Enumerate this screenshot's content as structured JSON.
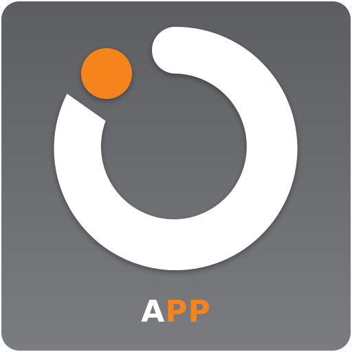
{
  "app": {
    "name_first": "A",
    "name_rest": "PP"
  },
  "colors": {
    "tile_top": "#5d5e62",
    "tile_bottom": "#7b7c80",
    "ring": "#ffffff",
    "dot": "#f5841f",
    "text_accent": "#f5841f",
    "text_white": "#ffffff"
  },
  "icon": {
    "symbol": "open-ring-with-orange-dot-logo"
  }
}
